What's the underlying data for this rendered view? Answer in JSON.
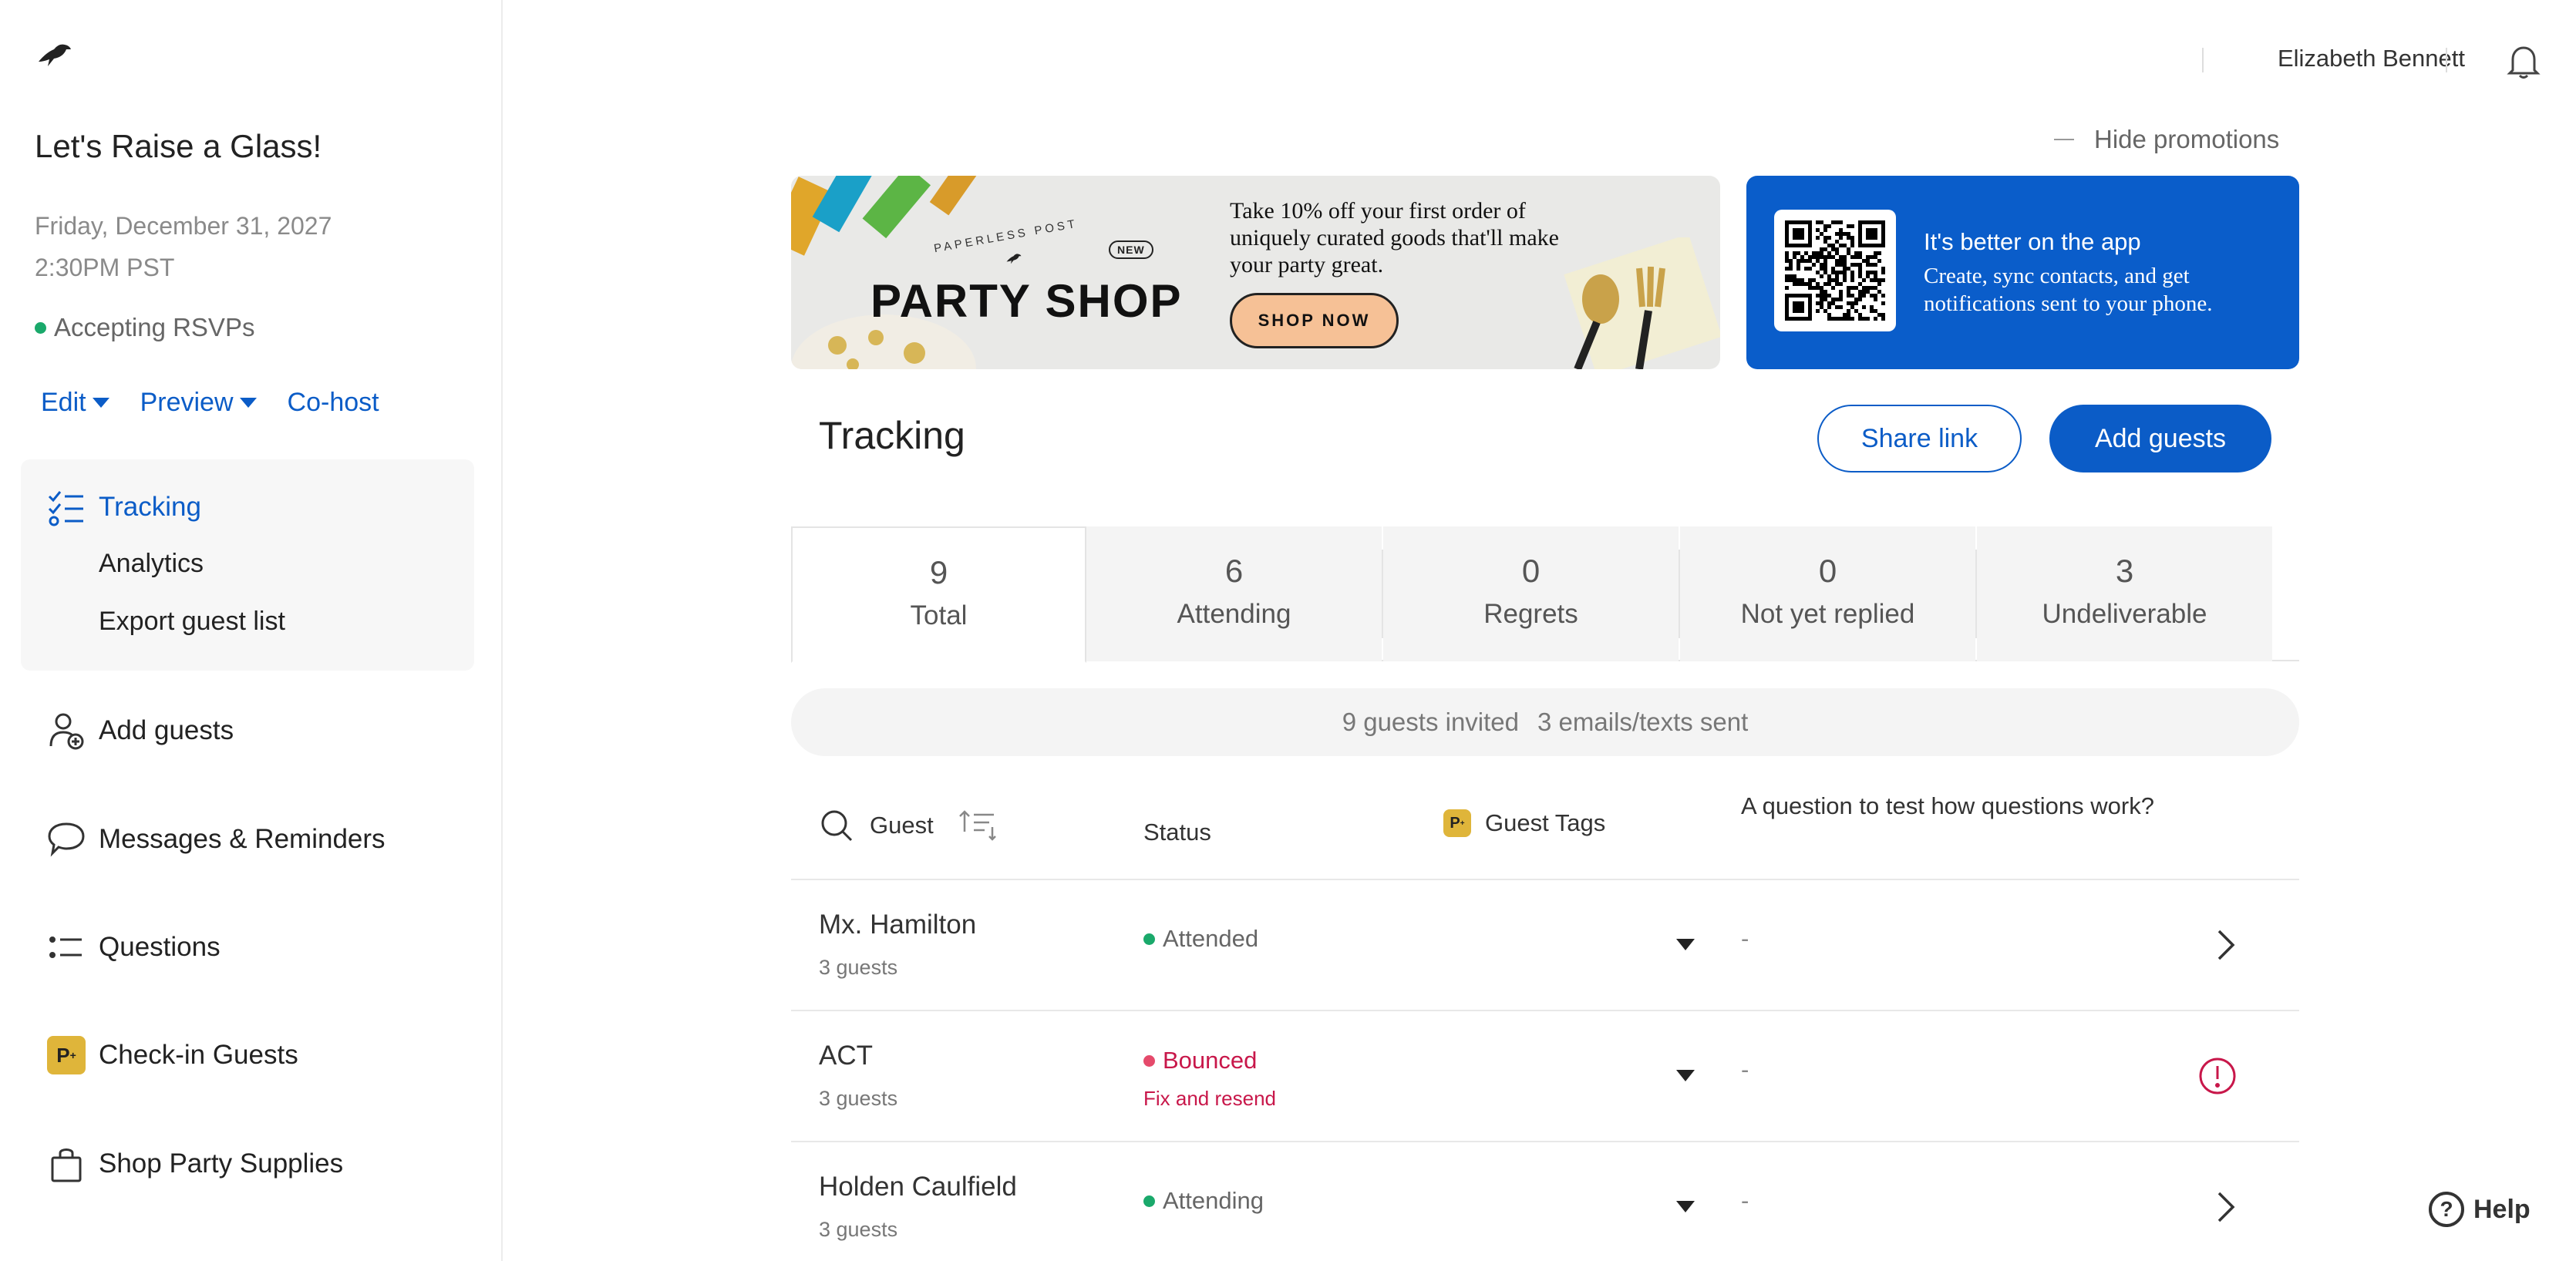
{
  "sidebar": {
    "event_title": "Let's Raise a Glass!",
    "event_date": "Friday, December 31, 2027",
    "event_time": "2:30PM PST",
    "rsvp_status": "Accepting RSVPs",
    "actions": {
      "edit": "Edit",
      "preview": "Preview",
      "cohost": "Co-host"
    },
    "tracking_group": {
      "title": "Tracking",
      "analytics": "Analytics",
      "export": "Export guest list"
    },
    "nav": {
      "add_guests": "Add guests",
      "messages": "Messages & Reminders",
      "questions": "Questions",
      "checkin": "Check-in Guests",
      "shop": "Shop Party Supplies"
    }
  },
  "topbar": {
    "user_name": "Elizabeth Bennett"
  },
  "promotions": {
    "hide_label": "Hide promotions",
    "shop": {
      "brand": "PAPERLESS POST",
      "badge": "NEW",
      "title": "PARTY SHOP",
      "text": "Take 10% off your first order of uniquely curated goods that'll make your party great.",
      "button": "SHOP NOW"
    },
    "app": {
      "title": "It's better on the app",
      "text": "Create, sync contacts, and get notifications sent to your phone."
    }
  },
  "main": {
    "title": "Tracking",
    "share_link": "Share link",
    "add_guests": "Add guests",
    "stats": [
      {
        "value": "9",
        "label": "Total"
      },
      {
        "value": "6",
        "label": "Attending"
      },
      {
        "value": "0",
        "label": "Regrets"
      },
      {
        "value": "0",
        "label": "Not yet replied"
      },
      {
        "value": "3",
        "label": "Undeliverable"
      }
    ],
    "summary": {
      "invited": "9 guests invited",
      "sent": "3 emails/texts sent"
    },
    "table": {
      "headers": {
        "guest": "Guest",
        "status": "Status",
        "tags": "Guest Tags",
        "question": "A question to test how questions work?"
      },
      "rows": [
        {
          "name": "Mx. Hamilton",
          "count": "3 guests",
          "status": "Attended",
          "answer": "-"
        },
        {
          "name": "ACT",
          "count": "3 guests",
          "status": "Bounced",
          "fix": "Fix and resend",
          "answer": "-"
        },
        {
          "name": "Holden Caulfield",
          "count": "3 guests",
          "status": "Attending",
          "answer": "-"
        }
      ]
    }
  },
  "help": {
    "label": "Help"
  },
  "colors": {
    "accent": "#0b5cc7",
    "success": "#1aa96b",
    "error": "#c8174a",
    "tag": "#dfb53a"
  }
}
